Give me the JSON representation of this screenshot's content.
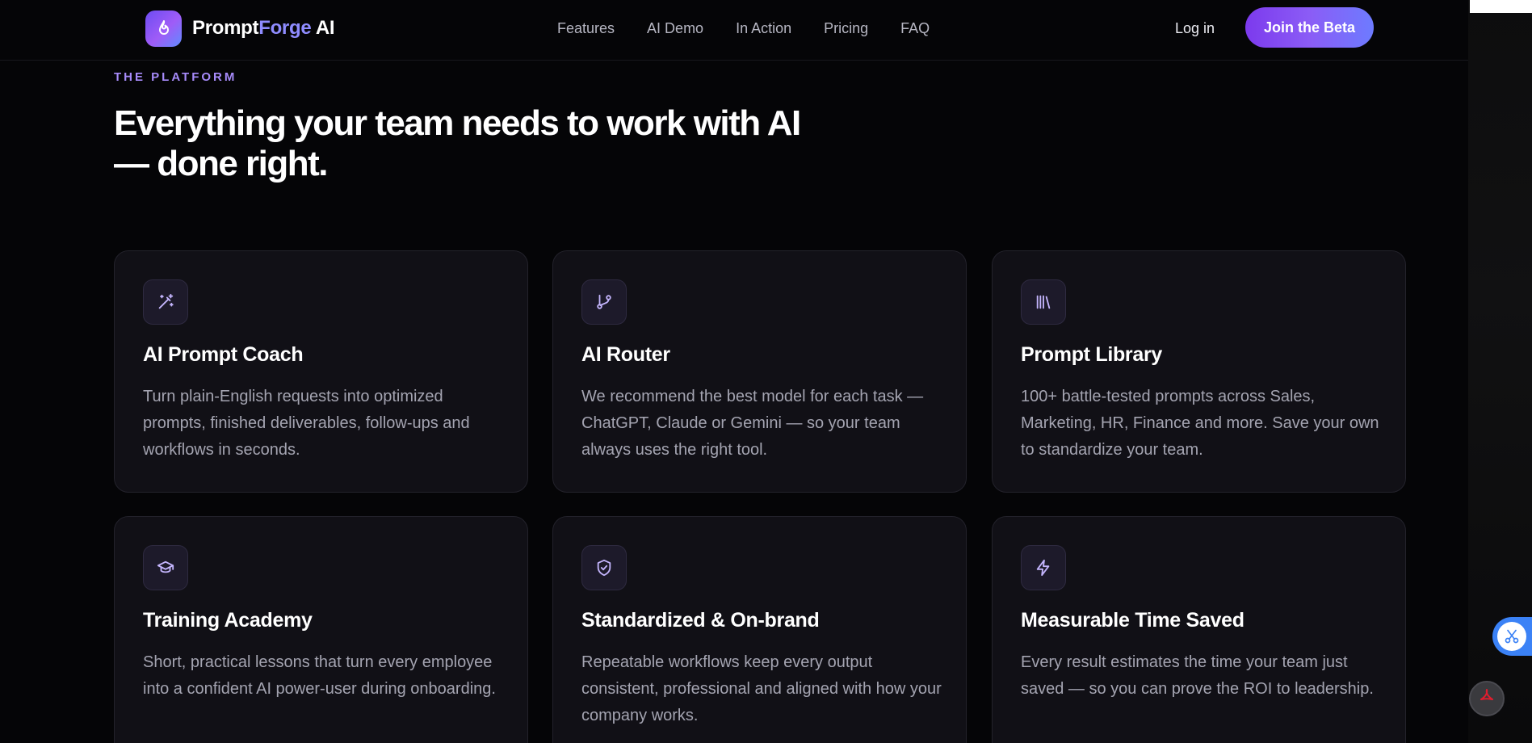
{
  "brand": {
    "name_part1": "Prompt",
    "name_part2": "Forge",
    "name_part3": " AI",
    "icon": "flame-icon"
  },
  "nav": {
    "links": [
      {
        "label": "Features"
      },
      {
        "label": "AI Demo"
      },
      {
        "label": "In Action"
      },
      {
        "label": "Pricing"
      },
      {
        "label": "FAQ"
      }
    ],
    "login_label": "Log in",
    "cta_label": "Join the Beta"
  },
  "hero": {
    "eyebrow": "THE PLATFORM",
    "headline_line1": "Everything your team needs to work with AI",
    "headline_line2": "— done right."
  },
  "features": [
    {
      "icon": "magic-wand-icon",
      "title": "AI Prompt Coach",
      "description": "Turn plain-English requests into optimized prompts, finished deliverables, follow-ups and workflows in seconds."
    },
    {
      "icon": "git-branch-icon",
      "title": "AI Router",
      "description": "We recommend the best model for each task — ChatGPT, Claude or Gemini — so your team always uses the right tool."
    },
    {
      "icon": "library-icon",
      "title": "Prompt Library",
      "description": "100+ battle-tested prompts across Sales, Marketing, HR, Finance and more. Save your own to standardize your team."
    },
    {
      "icon": "graduation-cap-icon",
      "title": "Training Academy",
      "description": "Short, practical lessons that turn every employee into a confident AI power-user during onboarding."
    },
    {
      "icon": "shield-check-icon",
      "title": "Standardized & On-brand",
      "description": "Repeatable workflows keep every output consistent, professional and aligned with how your company works."
    },
    {
      "icon": "lightning-icon",
      "title": "Measurable Time Saved",
      "description": "Every result estimates the time your team just saved — so you can prove the ROI to leadership."
    }
  ],
  "colors": {
    "background": "#050507",
    "card_background": "#111016",
    "accent_purple": "#8b5cf6",
    "eyebrow": "#a78bfa",
    "body_text": "#a4a4b1"
  }
}
